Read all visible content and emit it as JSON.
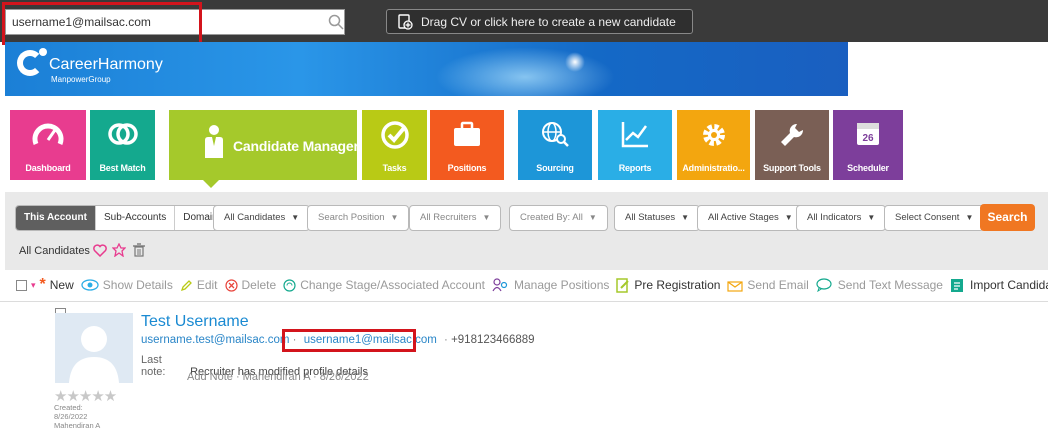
{
  "topbar": {
    "search_value": "username1@mailsac.com",
    "drag_label": "Drag CV or click here to create a new candidate"
  },
  "branding": {
    "name": "CareerHarmony",
    "sub": "ManpowerGroup"
  },
  "modules": [
    {
      "label": "Dashboard",
      "color": "#e83c8f",
      "icon": "gauge-icon"
    },
    {
      "label": "Best Match",
      "color": "#14a98e",
      "icon": "match-icon"
    },
    {
      "label": "Candidate Manager",
      "color": "#a5c92b",
      "icon": "person-icon"
    },
    {
      "label": "Tasks",
      "color": "#b9ca15",
      "icon": "check-icon"
    },
    {
      "label": "Positions",
      "color": "#f35a1f",
      "icon": "briefcase-icon"
    },
    {
      "label": "Sourcing",
      "color": "#1d96d8",
      "icon": "globe-search-icon"
    },
    {
      "label": "Reports",
      "color": "#2aaee6",
      "icon": "chart-line-icon"
    },
    {
      "label": "Administratio...",
      "color": "#f3a60f",
      "icon": "gear-icon"
    },
    {
      "label": "Support Tools",
      "color": "#7a5f55",
      "icon": "wrench-icon"
    },
    {
      "label": "Scheduler",
      "color": "#7d3e9b",
      "icon": "calendar-icon",
      "badge": "26"
    }
  ],
  "filters": {
    "scope": [
      "This Account",
      "Sub-Accounts",
      "Domain"
    ],
    "all_candidates": "All Candidates",
    "search_position": "Search Position",
    "all_recruiters": "All Recruiters",
    "created_by": "Created By: All",
    "all_statuses": "All Statuses",
    "all_active_stages": "All Active Stages",
    "all_indicators": "All Indicators",
    "select_consent": "Select Consent",
    "search_button": "Search",
    "list_title": "All Candidates"
  },
  "actions": {
    "new": "New",
    "show_details": "Show Details",
    "edit": "Edit",
    "delete": "Delete",
    "change_stage": "Change Stage/Associated Account",
    "manage_positions": "Manage Positions",
    "pre_registration": "Pre Registration",
    "send_email": "Send Email",
    "send_text": "Send Text Message",
    "import_candidates": "Import Candidates"
  },
  "candidate": {
    "name": "Test Username",
    "email1": "username.test@mailsac.com",
    "sep": "·",
    "email2": "username1@mailsac.com",
    "phone": "+918123466889",
    "last_note_label": "Last note:",
    "last_note": "Recruiter has modified profile details",
    "add_note": "Add Note",
    "note_author": "Mahendiran A",
    "note_date": "8/26/2022",
    "stars": "★★★★★",
    "created_label": "Created:",
    "created_date": "8/26/2022",
    "created_by": "Mahendiran A"
  }
}
